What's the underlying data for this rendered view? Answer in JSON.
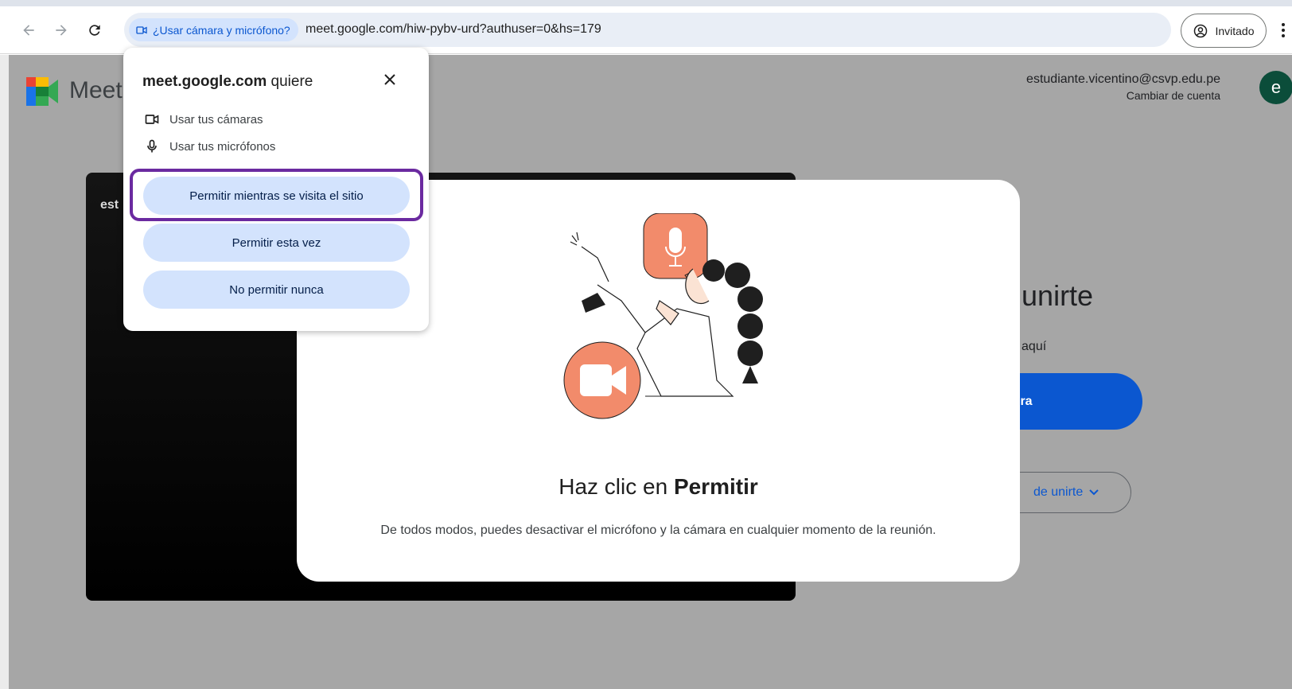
{
  "browser": {
    "permission_chip": "¿Usar cámara y micrófono?",
    "url": "meet.google.com/hiw-pybv-urd?authuser=0&hs=179",
    "profile_label": "Invitado"
  },
  "header": {
    "app_name": "Meet",
    "account_email": "estudiante.vicentino@csvp.edu.pe",
    "switch_account": "Cambiar de cuenta",
    "avatar_letter": "e"
  },
  "preview": {
    "name_label": "est"
  },
  "join_panel": {
    "title": "es unirte",
    "subtitle": "e más aquí",
    "join_button": "ahora",
    "other_button": "de unirte"
  },
  "modal": {
    "title_prefix": "Haz clic en ",
    "title_bold": "Permitir",
    "body": "De todos modos, puedes desactivar el micrófono y la cámara en cualquier momento de la reunión."
  },
  "popup": {
    "site": "meet.google.com",
    "wants": " quiere",
    "permissions": [
      "Usar tus cámaras",
      "Usar tus micrófonos"
    ],
    "buttons": [
      "Permitir mientras se visita el sitio",
      "Permitir esta vez",
      "No permitir nunca"
    ]
  },
  "colors": {
    "page_dim": "#a6a6a6",
    "chip_bg": "#d3e3fd",
    "accent_blue": "#0b57d0",
    "highlight": "#6b2aa0",
    "illustration_orange": "#f28b6b"
  }
}
